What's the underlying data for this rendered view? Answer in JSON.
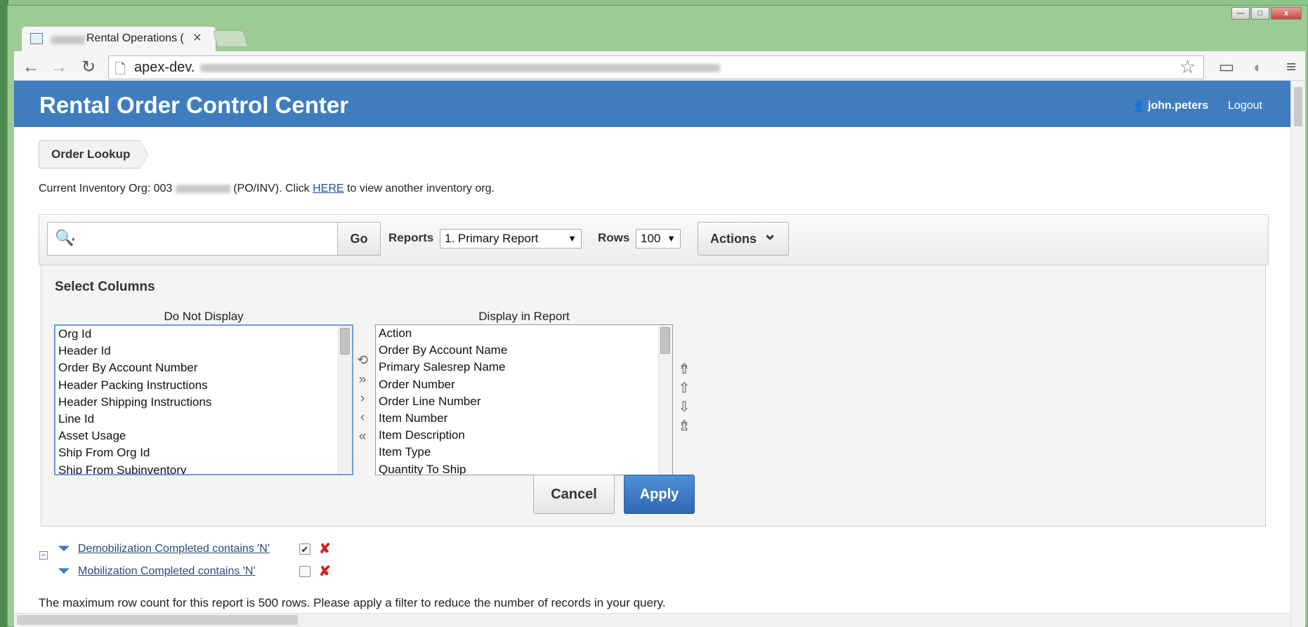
{
  "browser": {
    "tab_title": "Rental Operations (",
    "tab_close": "×",
    "url_prefix": "apex-dev.",
    "win_min": "—",
    "win_max": "□",
    "win_close": "x"
  },
  "icons": {
    "back": "←",
    "forward": "→",
    "reload": "↻",
    "page": "🗋",
    "star": "☆",
    "cast": "▭",
    "menu": "≡",
    "user": "👤",
    "search": "🔍",
    "chevron": "⌄",
    "funnel": "⏷"
  },
  "header": {
    "title": "Rental Order Control Center",
    "user": "john.peters",
    "logout": "Logout",
    "color": "#3f7dbf"
  },
  "breadcrumb": "Order Lookup",
  "org_line": {
    "prefix": "Current Inventory Org: 003",
    "suffix": "(PO/INV). Click",
    "link": "HERE",
    "after": "to view another inventory org."
  },
  "ir_toolbar": {
    "go": "Go",
    "reports_label": "Reports",
    "reports_value": "1. Primary Report",
    "rows_label": "Rows",
    "rows_value": "100",
    "actions": "Actions"
  },
  "select_columns": {
    "title": "Select Columns",
    "do_not_display_header": "Do Not Display",
    "display_header": "Display in Report",
    "do_not_display": [
      "Org Id",
      "Header Id",
      "Order By Account Number",
      "Header Packing Instructions",
      "Header Shipping Instructions",
      "Line Id",
      "Asset Usage",
      "Ship From Org Id",
      "Ship From Subinventory"
    ],
    "display": [
      "Action",
      "Order By Account Name",
      "Primary Salesrep Name",
      "Order Number",
      "Order Line Number",
      "Item Number",
      "Item Description",
      "Item Type",
      "Quantity To Ship"
    ],
    "cancel": "Cancel",
    "apply": "Apply"
  },
  "filters": [
    {
      "text": "Demobilization Completed contains 'N'",
      "checked": "✔"
    },
    {
      "text": "Mobilization Completed contains 'N'",
      "checked": ""
    }
  ],
  "collapse": "−",
  "max_message": "The maximum row count for this report is 500 rows. Please apply a filter to reduce the number of records in your query."
}
